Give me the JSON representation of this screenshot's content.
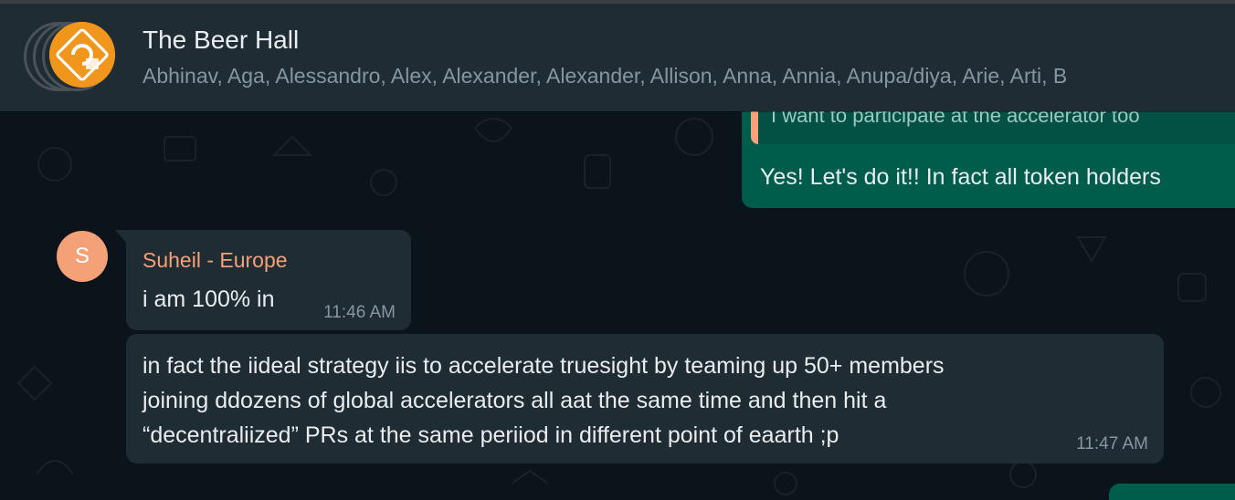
{
  "header": {
    "title": "The Beer Hall",
    "members": "Abhinav, Aga, Alessandro, Alex, Alexander, Alexander, Allison, Anna, Annia, Anupa/diya, Arie, Arti, B"
  },
  "messages": {
    "outgoing": {
      "quoted_text": "I want to participate at the accelerator too",
      "text": "Yes! Let's do it!! In fact all token holders"
    },
    "incoming": [
      {
        "avatar_initial": "S",
        "sender": "Suheil - Europe",
        "text": "i am 100% in",
        "time": "11:46 AM"
      },
      {
        "lines": [
          "in fact the iideal strategy iis to accelerate truesight by teaming up 50+ members",
          "joining ddozens of global accelerators all aat the same time and then hit a",
          "“decentraliized” PRs at the same periiod in different point of eaarth ;p"
        ],
        "time": "11:47 AM"
      }
    ]
  },
  "colors": {
    "background": "#0b141a",
    "header": "#202c33",
    "outgoing_bubble": "#005c4b",
    "incoming_bubble": "#202c33",
    "sender_name": "#f4a178",
    "group_avatar": "#f0961d"
  },
  "icons": {
    "group_avatar": "group-logo-icon"
  }
}
